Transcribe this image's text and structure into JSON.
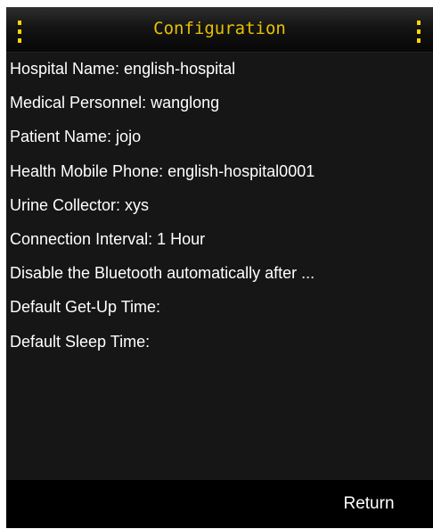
{
  "header": {
    "title": "Configuration",
    "menu_icon_left": "vertical-dots-icon",
    "menu_icon_right": "vertical-dots-icon",
    "accent_color": "#e6c200"
  },
  "settings": {
    "items": [
      "Hospital Name: english-hospital",
      "Medical Personnel: wanglong",
      "Patient Name: jojo",
      "Health Mobile Phone: english-hospital0001",
      "Urine Collector: xys",
      "Connection Interval: 1 Hour",
      "Disable the Bluetooth automatically after ...",
      "Default Get-Up Time:",
      "Default Sleep Time:"
    ]
  },
  "footer": {
    "return_label": "Return"
  }
}
